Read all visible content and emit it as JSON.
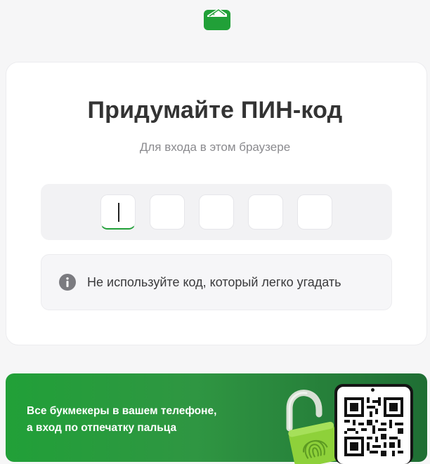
{
  "logo": {
    "icon": "wallet-app-logo-icon",
    "color": "#21a038"
  },
  "pin_setup": {
    "title": "Придумайте ПИН-код",
    "subtitle": "Для входа в этом браузере",
    "digits": [
      "",
      "",
      "",
      "",
      ""
    ],
    "active_index": 0
  },
  "hint": {
    "icon": "info-icon",
    "text": "Не используйте код, который легко угадать"
  },
  "promo": {
    "line1": "Все букмекеры в вашем телефоне,",
    "line2": "а вход по отпечатку пальца",
    "lock_icon": "fingerprint-padlock-icon",
    "qr_icon": "qr-code-icon",
    "accent": "#21a038"
  }
}
